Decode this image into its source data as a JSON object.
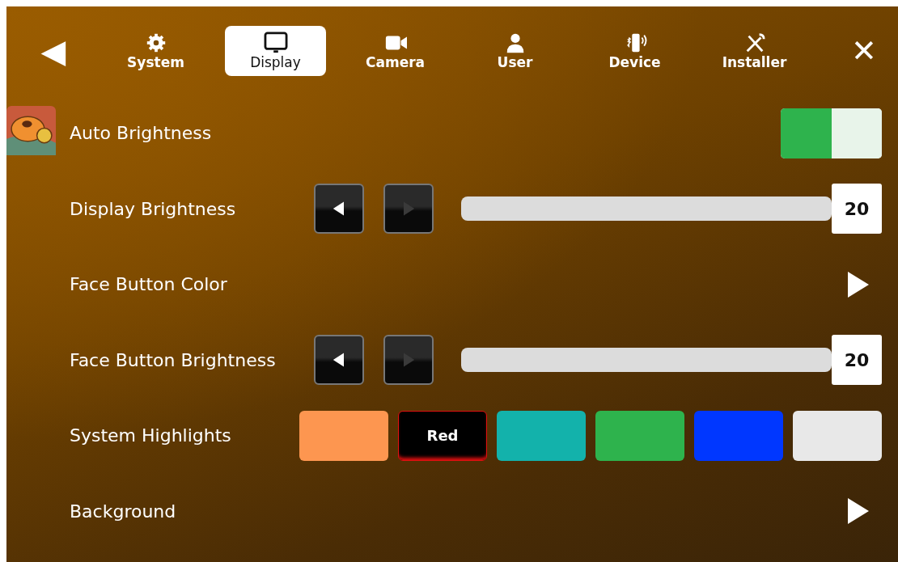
{
  "nav": {
    "back_label": "◀",
    "close_label": "✕",
    "tabs": [
      {
        "label": "System",
        "kind": "gear",
        "selected": false
      },
      {
        "label": "Display",
        "kind": "monitor",
        "selected": true
      },
      {
        "label": "Camera",
        "kind": "camera",
        "selected": false
      },
      {
        "label": "User",
        "kind": "person",
        "selected": false
      },
      {
        "label": "Device",
        "kind": "phone",
        "selected": false
      },
      {
        "label": "Installer",
        "kind": "tools",
        "selected": false
      }
    ]
  },
  "rows": [
    {
      "kind": "toggle",
      "label": "Auto Brightness",
      "on": true
    },
    {
      "kind": "slider",
      "label": "Display Brightness",
      "level": 1.0,
      "reading": "20",
      "decrease_disabled": false,
      "increase_disabled": true
    },
    {
      "kind": "link",
      "label": "Face Button Color"
    },
    {
      "kind": "slider",
      "label": "Face Button Brightness",
      "level": 1.0,
      "reading": "20",
      "decrease_disabled": false,
      "increase_disabled": true
    },
    {
      "kind": "swatches",
      "label": "System Highlights",
      "swatches": [
        {
          "color": "#fd9650",
          "selected": false
        },
        {
          "color": "#e01010",
          "selected": true,
          "label": "Red"
        },
        {
          "color": "#13b2ab",
          "selected": false
        },
        {
          "color": "#2eb34d",
          "selected": false
        },
        {
          "color": "#0037ff",
          "selected": false
        },
        {
          "color": "#e8e8e8",
          "selected": false
        }
      ]
    },
    {
      "kind": "link",
      "label": "Background"
    }
  ]
}
